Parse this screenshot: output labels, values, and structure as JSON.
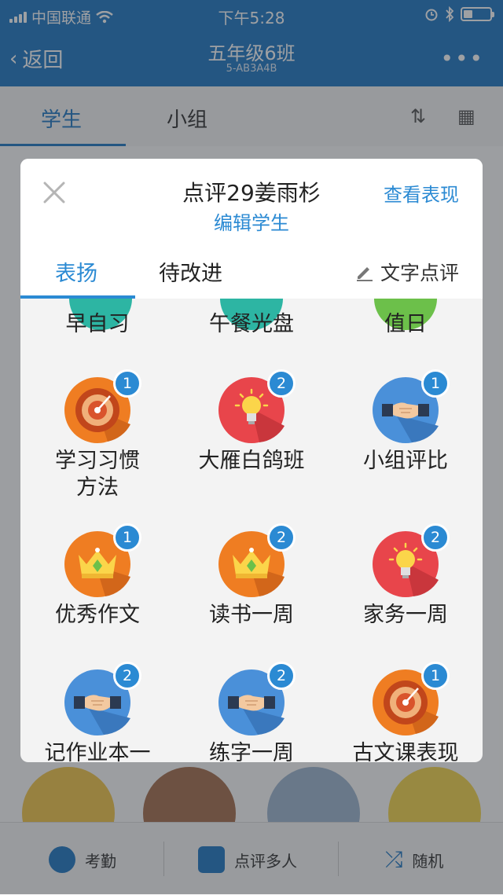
{
  "status_bar": {
    "carrier": "中国联通",
    "time": "下午5:28"
  },
  "nav": {
    "back_label": "返回",
    "title": "五年级6班",
    "subtitle": "5-AB3A4B",
    "more": "•••"
  },
  "bg_tabs": {
    "students": "学生",
    "groups": "小组"
  },
  "bottom_bar": {
    "attendance": "考勤",
    "multi_review": "点评多人",
    "random": "随机"
  },
  "dialog": {
    "title": "点评29姜雨杉",
    "edit_student": "编辑学生",
    "view_performance": "查看表现",
    "tabs": {
      "praise": "表扬",
      "improve": "待改进",
      "text_review": "文字点评"
    },
    "items": [
      {
        "label": "早自习",
        "icon": "partial-icon-teal",
        "badge": ""
      },
      {
        "label": "午餐光盘",
        "icon": "partial-icon-teal",
        "badge": ""
      },
      {
        "label": "值日",
        "icon": "partial-icon-green",
        "badge": ""
      },
      {
        "label": "学习习惯方法",
        "label_line1": "学习习惯",
        "label_line2": "方法",
        "icon": "target-icon",
        "badge": "1"
      },
      {
        "label": "大雁白鸽班",
        "icon": "lightbulb-icon",
        "badge": "2"
      },
      {
        "label": "小组评比",
        "icon": "handshake-icon",
        "badge": "1"
      },
      {
        "label": "优秀作文",
        "icon": "crown-icon",
        "badge": "1"
      },
      {
        "label": "读书一周",
        "icon": "crown-icon",
        "badge": "2"
      },
      {
        "label": "家务一周",
        "icon": "lightbulb-icon",
        "badge": "2"
      },
      {
        "label": "记作业本一",
        "icon": "handshake-icon",
        "badge": "2"
      },
      {
        "label": "练字一周",
        "icon": "handshake-icon",
        "badge": "2"
      },
      {
        "label": "古文课表现",
        "icon": "target-icon",
        "badge": "1"
      }
    ]
  },
  "colors": {
    "accent": "#2b8ad3",
    "nav_blue": "#2278c3",
    "orange": "#ef7d22",
    "red": "#e8454b",
    "blue_circle": "#4a90d9"
  }
}
